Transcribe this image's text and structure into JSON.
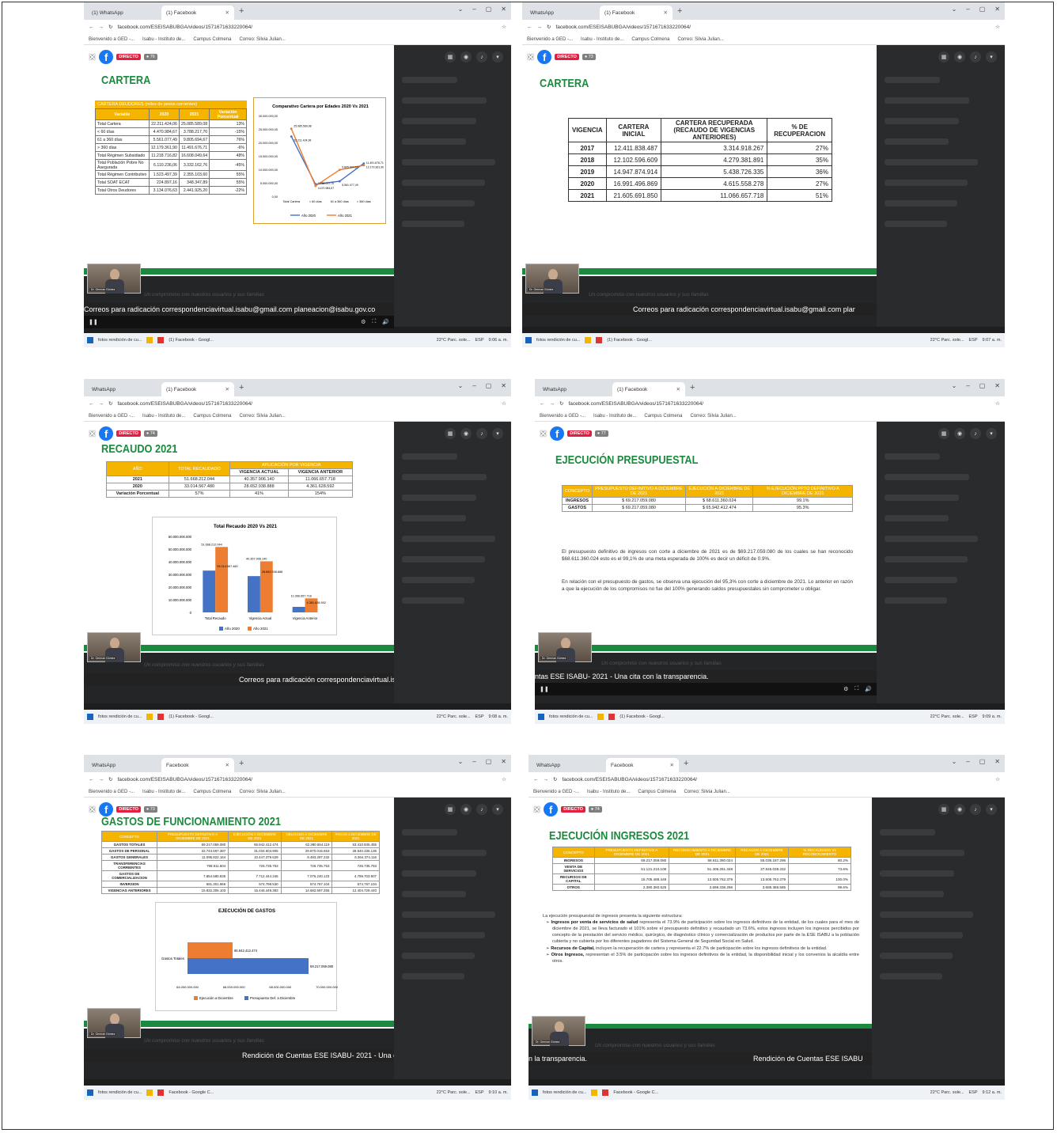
{
  "browser": {
    "tab_whatsapp": "WhatsApp",
    "tab_facebook_1": "(1) Facebook",
    "tab_facebook": "Facebook",
    "tab_whatsapp_1": "(1) WhatsApp",
    "url": "facebook.com/ESEISABUBGA/videos/1571671633220064/",
    "bookmarks": [
      "Bienvenido a GED -...",
      "Isabu - Instituto de...",
      "Campus Colmena",
      "Correo: Silvia Julian..."
    ]
  },
  "fb": {
    "live": "DIRECTO",
    "views": [
      "76",
      "73",
      "74",
      "77",
      "73",
      "74"
    ]
  },
  "common": {
    "motto": "Un compromiso con nuestros usuarios y sus familias",
    "presenter": "Dr. German Gómez",
    "ticker_emails": "Correos para radicación correspondenciavirtual.isabu@gmail.com planeacion@isabu.gov.co",
    "ticker_emails_cut": "Correos para radicación correspondenciavirtual.isabu@gmail.com plar",
    "ticker_emails_cut2": "Correos para radicación correspondenciavirtual.isab",
    "ticker_transp": "ntas ESE ISABU- 2021 - Una cita con la transparencia.",
    "ticker_rend": "Rendición de Cuentas ESE ISABU- 2021 - Una cita c",
    "ticker_transp2": "n la transparencia.",
    "ticker_rend2": "Rendición de Cuentas ESE ISABU",
    "weather": "22°C Parc. sole...",
    "lang": "ESP",
    "times": [
      "9:06 a. m.",
      "9:07 a. m.",
      "9:08 a. m.",
      "9:09 a. m.",
      "9:10 a. m.",
      "9:12 a. m."
    ],
    "task_fotos": "fotos rendición de cu...",
    "task_fb": "(1) Facebook - Googl...",
    "task_fb2": "Facebook - Google C..."
  },
  "s1": {
    "title": "CARTERA",
    "caption": "CARTERA DEUDORES (miles de pesos corrientes)",
    "headers": [
      "Variable",
      "2020",
      "2021",
      "Variación Porcentual"
    ],
    "rows": [
      [
        "Total Cartera",
        "22.211.424,06",
        "25.085.589,08",
        "13%"
      ],
      [
        "< 60 días",
        "4.470.984,67",
        "3.788.217,70",
        "-15%"
      ],
      [
        "61 a 360 días",
        "5.561.077,49",
        "9.805.694,67",
        "76%"
      ],
      [
        "> 360 días",
        "12.179.361,90",
        "11.491.676,71",
        "-6%"
      ],
      [
        "Total Régimen Subsidiado",
        "11.218.716,82",
        "16.608.049,64",
        "48%"
      ],
      [
        "Total Población Pobre No Asegurada",
        "6.110.236,06",
        "3.332.162,76",
        "-45%"
      ],
      [
        "Total Régimen Contributivo",
        "1.523.497,39",
        "2.355.103,60",
        "55%"
      ],
      [
        "Total SOAT ECAT",
        "224.897,16",
        "348.347,89",
        "55%"
      ],
      [
        "Total Otros Deudores",
        "3.134.076,63",
        "2.441.925,20",
        "-22%"
      ]
    ],
    "chart_title": "Comparativo Cartera por Edades 2020 Vs 2021",
    "chart_categories": [
      "Total Cartera",
      "< 60 días",
      "61 a 360 días",
      "> 360 días"
    ],
    "chart_ticks": [
      "30.000.000,00",
      "25.000.000,00",
      "20.000.000,00",
      "15.000.000,00",
      "10.000.000,00",
      "5.000.000,00",
      "0,00"
    ],
    "legend": [
      "Año 2020",
      "Año 2021"
    ],
    "colors": {
      "y2020": "#4472c4",
      "y2021": "#ed7d31"
    }
  },
  "s2": {
    "title": "CARTERA",
    "headers": [
      "VIGENCIA",
      "CARTERA INICIAL",
      "CARTERA RECUPERADA (RECAUDO DE VIGENCIAS ANTERIORES)",
      "% DE RECUPERACION"
    ],
    "rows": [
      [
        "2017",
        "12.411.838.487",
        "3.314.918.267",
        "27%"
      ],
      [
        "2018",
        "12.102.596.609",
        "4.279.381.891",
        "35%"
      ],
      [
        "2019",
        "14.947.874.914",
        "5.438.726.335",
        "36%"
      ],
      [
        "2020",
        "16.991.496.869",
        "4.615.558.278",
        "27%"
      ],
      [
        "2021",
        "21.605.691.850",
        "11.066.657.718",
        "51%"
      ]
    ]
  },
  "s3": {
    "title": "RECAUDO 2021",
    "headers": [
      "AÑO",
      "TOTAL RECAUDADO",
      "APLICACIÓN POR VIGENCIA",
      "VIGENCIA ACTUAL",
      "VIGENCIA ANTERIOR"
    ],
    "rows": [
      [
        "2021",
        "51.668.212.044",
        "40.357.906.140",
        "11.066.657.718"
      ],
      [
        "2020",
        "33.014.567.480",
        "28.652.938.888",
        "4.361.628.592"
      ],
      [
        "Variación Porcentual",
        "57%",
        "41%",
        "154%"
      ]
    ],
    "chart_title": "Total Recaudo 2020 Vs 2021",
    "categories": [
      "Total Recaudo",
      "Vigencia Actual",
      "Vigencia Anterior"
    ],
    "ticks": [
      "60.000.000.000",
      "50.000.000.000",
      "40.000.000.000",
      "30.000.000.000",
      "20.000.000.000",
      "10.000.000.000",
      "0"
    ],
    "legend": [
      "Año 2020",
      "Año 2021"
    ]
  },
  "s4": {
    "title": "EJECUCIÓN PRESUPUESTAL",
    "headers": [
      "CONCEPTO",
      "PRESUPUESTO DEFINITIVO A DICIEMBRE DE 2021",
      "EJECUCIÓN A DICIEMBRE DE 2021",
      "% EJECUCIÓN PPTO DEFINITIVO A DICIEMBRE DE 2021"
    ],
    "rows": [
      [
        "INGRESOS",
        "$ 69.217.059.080",
        "$ 68.611.360.024",
        "99.1%"
      ],
      [
        "GASTOS",
        "$ 69.217.059.080",
        "$ 65.942.412.474",
        "95.3%"
      ]
    ],
    "p1": "El presupuesto definitivo de ingresos con corte a diciembre de 2021 es de $69.217.059.080 de los cuales se han reconocido $68.611.360.024 esto es el 99,1% de una meta esperada de 100% es decir un déficit de 0.9%.",
    "p2": "En relación con el presupuesto de gastos, se observa una ejecución del 95,3% con corte a diciembre de 2021. Lo anterior en razón a que la ejecución de los compromisos no fue del 100% generando saldos presupuestales sin comprometer u obligar."
  },
  "s5": {
    "title": "GASTOS DE FUNCIONAMIENTO 2021",
    "headers": [
      "CONCEPTO",
      "PRESUPUESTO DEFINITIVO A DICIEMBRE DE 2021",
      "EJECUCIÓN A DICIEMBRE DE 2021",
      "OBLIGADO A DICIEMBRE DE 2021",
      "PAGOS A DICIEMBRE DE 2021"
    ],
    "rows": [
      [
        "GASTOS TOTALES",
        "69.217.059.080",
        "65.942.412.474",
        "62.380.654.119",
        "53.410.845.455"
      ],
      [
        "GASTOS DE PERSONAL",
        "32.743.597.387",
        "31.034.604.905",
        "29.870.016.653",
        "28.540.335.136"
      ],
      [
        "GASTOS GENERALES",
        "11.095.822.164",
        "10.447.379.629",
        "9.483.297.232",
        "6.364.374.116"
      ],
      [
        "TRANSFERENCIAS CORRIENTES",
        "798.911.604",
        "726.735.753",
        "726.735.753",
        "726.735.753"
      ],
      [
        "GASTOS DE COMERCIALIZACION",
        "7.854.580.835",
        "7.712.444.346",
        "7.076.240.123",
        "4.799.703.907"
      ],
      [
        "INVERSION",
        "681.301.966",
        "574.798.530",
        "574.767.104",
        "574.767.104"
      ],
      [
        "VIGENCIAS ANTERIORES",
        "15.832.305.103",
        "15.446.449.383",
        "14.682.597.255",
        "12.404.729.440"
      ]
    ],
    "chart_title": "EJECUCIÓN DE GASTOS",
    "category": "Gastos Totales",
    "ticks": [
      "64.000.000.000",
      "66.000.000.000",
      "68.000.000.000",
      "70.000.000.000"
    ],
    "label_exec": "65.942.412.474",
    "label_pres": "69.217.059.080",
    "legend": [
      "Ejecución a Diciembre",
      "Presupuesto Def. a Diciembre"
    ]
  },
  "s6": {
    "title": "EJECUCIÓN INGRESOS 2021",
    "headers": [
      "CONCEPTO",
      "PRESUPUESTO DEFINITIVO A DICIEMBRE DE 2021",
      "RECONOCIMIENTO A DICIEMBRE DE 2021",
      "RECAUDO A DICIEMBRE DE 2021",
      "% RECAUDADO Vs RECONOCIMIENTO"
    ],
    "rows": [
      [
        "INGRESOS",
        "69.217.059.080",
        "68.611.360.024",
        "55.036.187.296",
        "80.2%"
      ],
      [
        "VENTA DE SERVICIOS",
        "51.121.210.106",
        "51.406.261.348",
        "37.845.038.332",
        "73.6%"
      ],
      [
        "RECURSOS DE CAPITAL",
        "15.705.488.449",
        "13.505.762.379",
        "13.505.762.379",
        "100.0%"
      ],
      [
        "OTROS",
        "2.390.360.525",
        "3.699.336.296",
        "3.685.386.585",
        "99.6%"
      ]
    ],
    "intro": "La ejecución presupuestal de ingresos presenta la siguiente estructura:",
    "b1_bold": "Ingresos por venta de servicios de salud",
    "b1": " representa el 73.9% de participación sobre los ingresos definitivos de la entidad, de los cuales para el mes de diciembre de 2021, se lleva facturado el 101% sobre el presupuesto definitivo y recaudado un 73.6%, estos ingresos incluyen los ingresos percibidos por concepto de la prestación del servicio médico, quirúrgico, de diagnóstico clínico y comercialización de productos por parte de la ESE ISABU a la población cubierta y no cubierta por los diferentes pagadores del Sistema General de Seguridad Social en Salud.",
    "b2_bold": "Recursos de Capital,",
    "b2": " incluyen la recuperación de cartera y representa el 22.7% de participación sobre los ingresos definitivos de la entidad.",
    "b3_bold": "Otros Ingresos,",
    "b3": " representan el 3.5% de participación sobre los ingresos definitivos de la entidad, la disponibilidad inicial y los convenios la alcaldía entre otros."
  }
}
